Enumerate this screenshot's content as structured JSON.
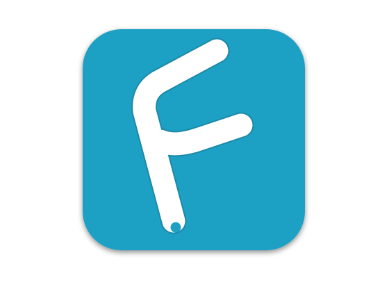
{
  "app_icon": {
    "icon": "letter-f-logo-icon",
    "glyph": "F",
    "colors": {
      "tile": "#1fa0c3",
      "glyph": "#ffffff",
      "glyph_outline": "#1c89a8",
      "shadow": "#9a9a9a"
    }
  }
}
